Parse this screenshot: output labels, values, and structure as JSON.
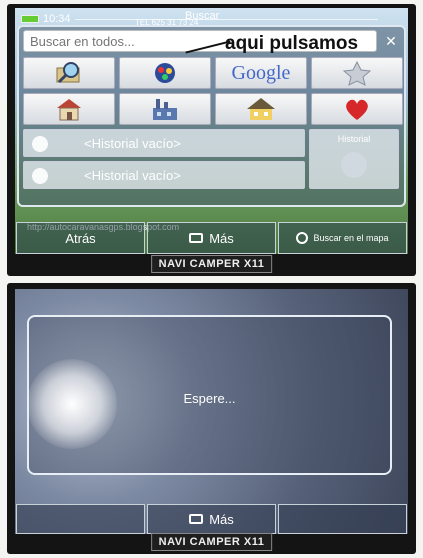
{
  "top_screen": {
    "status": {
      "time": "10:34",
      "phone": "TEL 625 31 73 24",
      "title": "Buscar"
    },
    "search": {
      "placeholder": "Buscar en todos..."
    },
    "annotation": "aqui pulsamos",
    "grid": [
      {
        "icon": "map-search-icon"
      },
      {
        "icon": "poi-icon"
      },
      {
        "icon": "google-icon",
        "label": "Google"
      },
      {
        "icon": "star-icon"
      },
      {
        "icon": "home-icon"
      },
      {
        "icon": "factory-icon"
      },
      {
        "icon": "house-icon"
      },
      {
        "icon": "heart-icon"
      }
    ],
    "history_rows": [
      "<Historial vacío>",
      "<Historial vacío>"
    ],
    "history_button": "Historial",
    "url": "http://autocaravanasgps.blogspot.com",
    "nav": {
      "back": "Atrás",
      "more": "Más",
      "map_search": "Buscar en el mapa"
    },
    "brand": "NAVI CAMPER X11"
  },
  "bottom_screen": {
    "dialog_text": "Espere...",
    "nav": {
      "more": "Más"
    },
    "brand": "NAVI CAMPER X11"
  },
  "colors": {
    "accent": "#4468c8",
    "heart": "#d62828"
  }
}
